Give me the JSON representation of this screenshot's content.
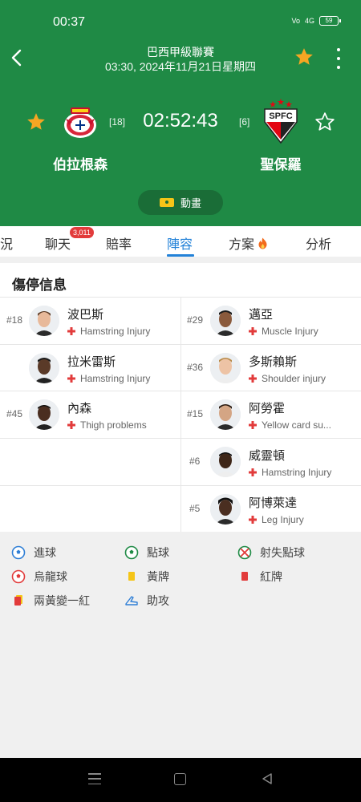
{
  "status_bar": {
    "time": "00:37",
    "network": "4G",
    "volte": "VoLTE",
    "battery": "59"
  },
  "match": {
    "league": "巴西甲級聯賽",
    "datetime": "03:30, 2024年11月21日星期四",
    "clock": "02:52:43",
    "home": {
      "name": "伯拉根森",
      "rank": "[18]",
      "logo": "red-bull-bragantino-logo"
    },
    "away": {
      "name": "聖保羅",
      "rank": "[6]",
      "logo": "sao-paulo-fc-logo",
      "logo_text": "SPFC"
    },
    "animation_label": "動畫"
  },
  "tabs": [
    {
      "label": "況"
    },
    {
      "label": "聊天",
      "badge": "3,011"
    },
    {
      "label": "賠率"
    },
    {
      "label": "陣容",
      "active": true
    },
    {
      "label": "方案"
    },
    {
      "label": "分析"
    }
  ],
  "injuries": {
    "title": "傷停信息",
    "home": [
      {
        "number": "#18",
        "name": "波巴斯",
        "injury": "Hamstring Injury"
      },
      {
        "number": "",
        "name": "拉米雷斯",
        "injury": "Hamstring Injury"
      },
      {
        "number": "#45",
        "name": "內森",
        "injury": "Thigh problems"
      }
    ],
    "away": [
      {
        "number": "#29",
        "name": "邁亞",
        "injury": "Muscle Injury"
      },
      {
        "number": "#36",
        "name": "多斯賴斯",
        "injury": "Shoulder injury"
      },
      {
        "number": "#15",
        "name": "阿勞霍",
        "injury": "Yellow card su..."
      },
      {
        "number": "#6",
        "name": "威靈頓",
        "injury": "Hamstring Injury"
      },
      {
        "number": "#5",
        "name": "阿博萊達",
        "injury": "Leg Injury"
      }
    ]
  },
  "legend": {
    "goal": "進球",
    "penalty": "點球",
    "missed_penalty": "射失點球",
    "own_goal": "烏龍球",
    "yellow_card": "黃牌",
    "red_card": "紅牌",
    "second_yellow": "兩黃變一紅",
    "assist": "助攻"
  },
  "colors": {
    "header_green": "#1f8a45",
    "accent_blue": "#2382d8",
    "star_gold": "#f5a623",
    "badge_red": "#e23b3b"
  }
}
